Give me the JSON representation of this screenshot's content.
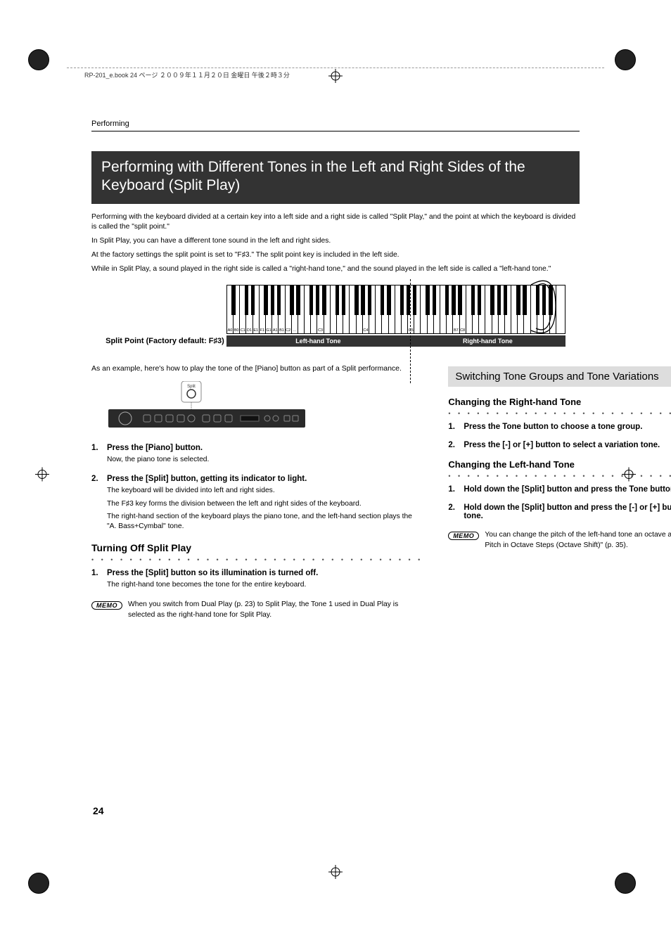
{
  "header": {
    "book_info": "RP-201_e.book 24 ページ ２００９年１１月２０日 金曜日 午後２時３分",
    "running_head": "Performing"
  },
  "title": "Performing with Different Tones in the Left and Right Sides of the Keyboard (Split Play)",
  "intro": {
    "p1": "Performing with the keyboard divided at a certain key into a left side and a right side is called \"Split Play,\" and the point at which the keyboard is divided is called the \"split point.\"",
    "p2": "In Split Play, you can have a different tone sound in the left and right sides.",
    "p3a": "At the factory settings the split point is set to \"F",
    "p3b": "3.\" The split point key is included in the left side.",
    "p4": "While in Split Play, a sound played in the right side is called a \"right-hand tone,\" and the sound played in the left side is called a \"left-hand tone.\""
  },
  "diagram": {
    "title_a": "Split Point (Factory default: F",
    "title_b": "3)",
    "left_label": "Left-hand Tone",
    "right_label": "Right-hand Tone",
    "key_labels": [
      "A0",
      "B0",
      "C1",
      "D1",
      "E1",
      "F1",
      "G1",
      "A1",
      "B1",
      "C2",
      "…",
      "",
      "",
      "",
      "C3",
      "",
      "",
      "",
      "",
      "",
      "",
      "C4",
      "",
      "",
      "",
      "",
      "",
      "",
      "C5",
      "",
      "",
      "",
      "",
      "",
      "",
      "B7",
      "C8"
    ]
  },
  "left_col": {
    "lead": "As an example, here's how to play the tone of the [Piano] button as part of a Split performance.",
    "panel": {
      "split_label": "Split"
    },
    "step1": {
      "num": "1.",
      "title": "Press the [Piano] button.",
      "text": "Now, the piano tone is selected."
    },
    "step2": {
      "num": "2.",
      "title": "Press the [Split] button, getting its indicator to light.",
      "t1": "The keyboard will be divided into left and right sides.",
      "t2a": "The F",
      "t2b": "3 key forms the division between the left and right sides of the keyboard.",
      "t3": "The right-hand section of the keyboard plays the piano tone, and the left-hand section plays the \"A. Bass+Cymbal\" tone."
    },
    "h3": "Turning Off Split Play",
    "step3": {
      "num": "1.",
      "title": "Press the [Split] button so its illumination is turned off.",
      "text": "The right-hand tone becomes the tone for the entire keyboard."
    },
    "memo_label": "MEMO",
    "memo": "When you switch from Dual Play (p. 23) to Split Play, the Tone 1 used in Dual Play is selected as the right-hand tone for Split Play."
  },
  "right_col": {
    "sub_heading": "Switching Tone Groups and Tone Variations",
    "h4a": "Changing the Right-hand Tone",
    "ra1": {
      "num": "1.",
      "title": "Press the Tone button to choose a tone group."
    },
    "ra2": {
      "num": "2.",
      "title": "Press the [-] or [+] button to select a variation tone."
    },
    "h4b": "Changing the Left-hand Tone",
    "rb1": {
      "num": "1.",
      "title": "Hold down the [Split] button and press the Tone button to choose a tone group."
    },
    "rb2": {
      "num": "2.",
      "title": "Hold down the [Split] button and press the [-] or [+] button to select a variation tone."
    },
    "memo_label": "MEMO",
    "memo": "You can change the pitch of the left-hand tone an octave at a time. Refer to  \"Changing the Pitch in Octave Steps (Octave Shift)\" (p. 35)."
  },
  "page_number": "24"
}
